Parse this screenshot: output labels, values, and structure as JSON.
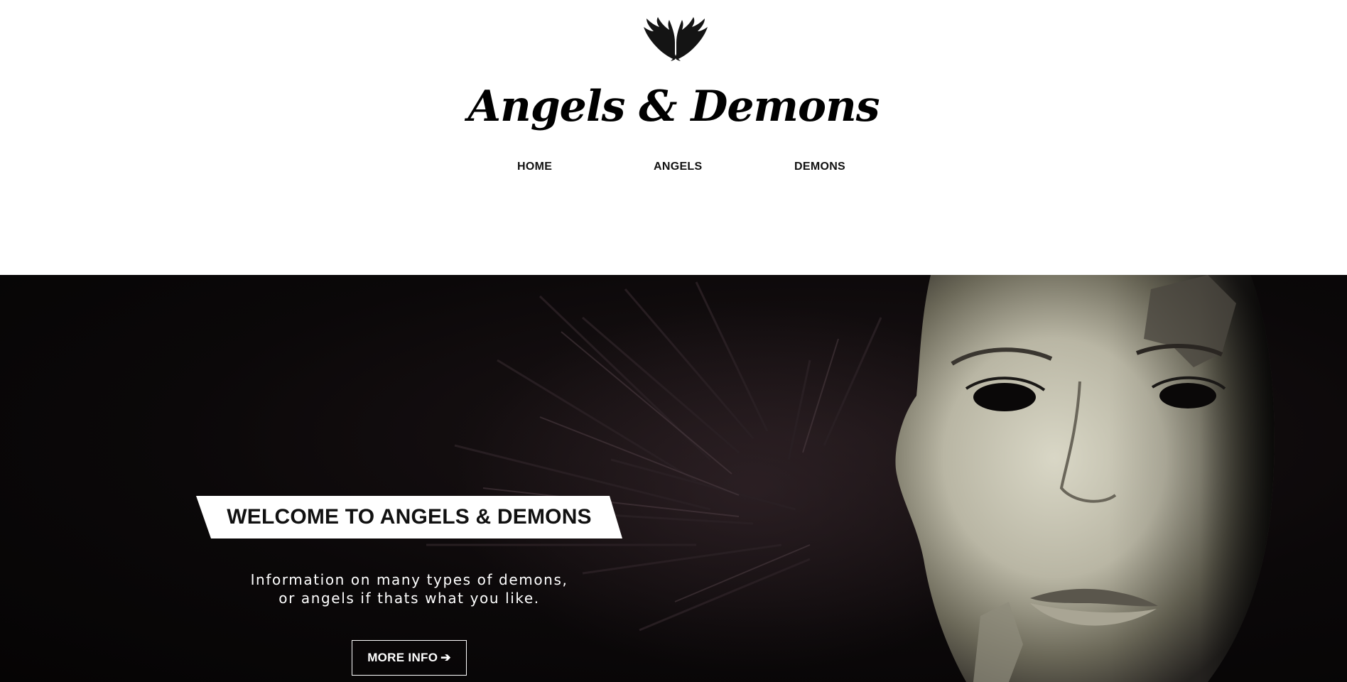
{
  "header": {
    "site_title": "Angels & Demons",
    "logo_icon": "wings-icon"
  },
  "nav": {
    "items": [
      {
        "label": "HOME"
      },
      {
        "label": "ANGELS"
      },
      {
        "label": "DEMONS"
      }
    ]
  },
  "hero": {
    "welcome_title": "WELCOME TO ANGELS & DEMONS",
    "tagline_line1": "Information on many types of demons,",
    "tagline_line2": "or angels if thats what you like.",
    "cta_label": "MORE INFO",
    "cta_arrow": "➔",
    "image": "dark-angel-woman-portrait"
  },
  "colors": {
    "page_background": "#ffffff",
    "hero_background": "#0b0809",
    "text_dark": "#111111",
    "text_light": "#ffffff"
  }
}
